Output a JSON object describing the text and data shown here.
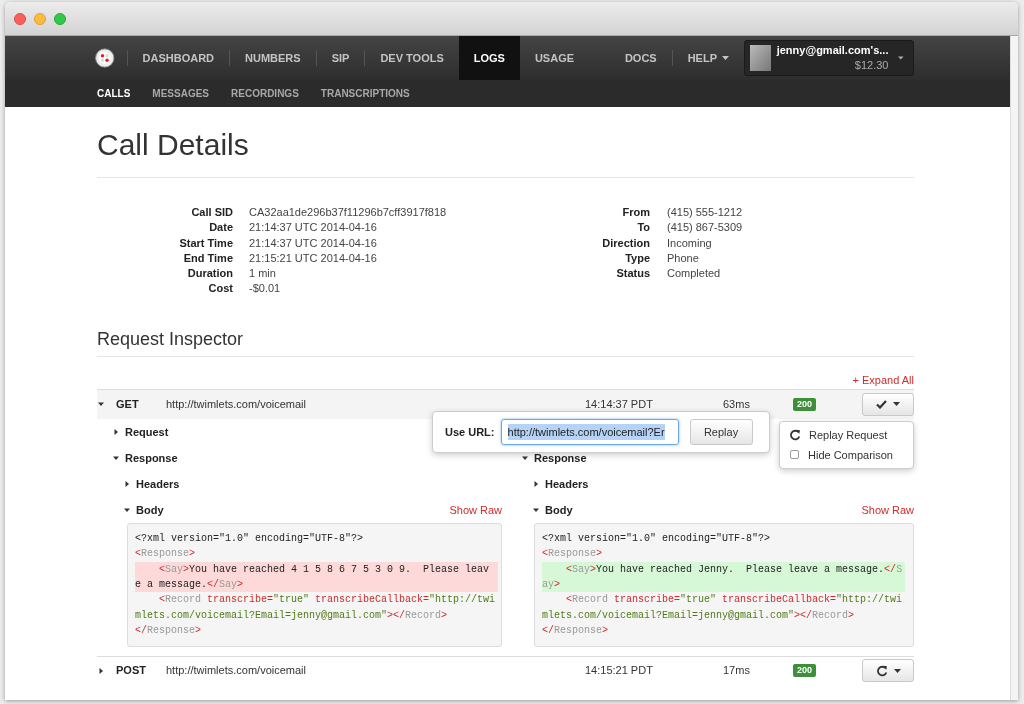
{
  "nav": {
    "main": [
      {
        "label": "DASHBOARD",
        "selected": false,
        "dropdown": false
      },
      {
        "label": "NUMBERS",
        "selected": false,
        "dropdown": false
      },
      {
        "label": "SIP",
        "selected": false,
        "dropdown": false
      },
      {
        "label": "DEV TOOLS",
        "selected": false,
        "dropdown": false
      },
      {
        "label": "LOGS",
        "selected": true,
        "dropdown": false
      },
      {
        "label": "USAGE",
        "selected": false,
        "dropdown": false
      }
    ],
    "secondary": [
      {
        "label": "DOCS",
        "selected": false,
        "dropdown": false
      },
      {
        "label": "HELP",
        "selected": false,
        "dropdown": true
      }
    ],
    "account": {
      "name": "jenny@gmail.com's...",
      "balance": "$12.30"
    }
  },
  "subnav": [
    {
      "label": "CALLS",
      "selected": true
    },
    {
      "label": "MESSAGES",
      "selected": false
    },
    {
      "label": "RECORDINGS",
      "selected": false
    },
    {
      "label": "TRANSCRIPTIONS",
      "selected": false
    }
  ],
  "title": "Call Details",
  "details_left": [
    {
      "label": "Call SID",
      "value": "CA32aa1de296b37f11296b7cff3917f818"
    },
    {
      "label": "Date",
      "value": "21:14:37 UTC 2014-04-16"
    },
    {
      "label": "Start Time",
      "value": "21:14:37 UTC 2014-04-16"
    },
    {
      "label": "End Time",
      "value": "21:15:21 UTC 2014-04-16"
    },
    {
      "label": "Duration",
      "value": "1 min"
    },
    {
      "label": "Cost",
      "value": "-$0.01"
    }
  ],
  "details_right": [
    {
      "label": "From",
      "value": "(415) 555-1212"
    },
    {
      "label": "To",
      "value": "(415) 867-5309"
    },
    {
      "label": "Direction",
      "value": "Incoming"
    },
    {
      "label": "Type",
      "value": "Phone"
    },
    {
      "label": "Status",
      "value": "Completed"
    }
  ],
  "inspector": {
    "title": "Request Inspector",
    "expand_all": "+ Expand All",
    "requests": [
      {
        "method": "GET",
        "url": "http://twimlets.com/voicemail",
        "time": "14:14:37 PDT",
        "duration": "63ms",
        "status": "200",
        "kind": "check",
        "expanded": true,
        "columns": [
          {
            "sections": [
              {
                "label": "Request",
                "expanded": false
              },
              {
                "label": "Response",
                "expanded": true,
                "children": [
                  {
                    "label": "Headers",
                    "expanded": false
                  },
                  {
                    "label": "Body",
                    "expanded": true,
                    "link": "Show Raw",
                    "code": [
                      {
                        "kind": "plain",
                        "tokens": [
                          {
                            "kind": "text",
                            "text": "<?xml version=\"1.0\" encoding=\"UTF-8\"?>"
                          }
                        ]
                      },
                      {
                        "kind": "plain",
                        "tokens": [
                          {
                            "kind": "punct",
                            "text": "<"
                          },
                          {
                            "kind": "tag",
                            "text": "Response"
                          },
                          {
                            "kind": "punct",
                            "text": ">"
                          }
                        ]
                      },
                      {
                        "kind": "removed",
                        "tokens": [
                          {
                            "kind": "punct",
                            "text": "    <"
                          },
                          {
                            "kind": "tag",
                            "text": "Say"
                          },
                          {
                            "kind": "punct",
                            "text": ">"
                          },
                          {
                            "kind": "text",
                            "text": "You have reached 4 1 5 8 6 7 5 3 0 9.  Please leave a message."
                          },
                          {
                            "kind": "punct",
                            "text": "</"
                          },
                          {
                            "kind": "tag",
                            "text": "Say"
                          },
                          {
                            "kind": "punct",
                            "text": ">"
                          }
                        ]
                      },
                      {
                        "kind": "plain",
                        "tokens": [
                          {
                            "kind": "punct",
                            "text": "    <"
                          },
                          {
                            "kind": "tag",
                            "text": "Record"
                          },
                          {
                            "kind": "attr",
                            "text": " transcribe="
                          },
                          {
                            "kind": "value",
                            "text": "\"true\""
                          },
                          {
                            "kind": "attr",
                            "text": " transcribeCallback="
                          },
                          {
                            "kind": "value",
                            "text": "\"http://twimlets.com/voicemail?Email=jenny@gmail.com\""
                          },
                          {
                            "kind": "punct",
                            "text": "></"
                          },
                          {
                            "kind": "tag",
                            "text": "Record"
                          },
                          {
                            "kind": "punct",
                            "text": ">"
                          }
                        ]
                      },
                      {
                        "kind": "plain",
                        "tokens": [
                          {
                            "kind": "punct",
                            "text": "</"
                          },
                          {
                            "kind": "tag",
                            "text": "Response"
                          },
                          {
                            "kind": "punct",
                            "text": ">"
                          }
                        ]
                      }
                    ]
                  }
                ]
              }
            ]
          },
          {
            "sections": [
              {
                "label": "Response",
                "expanded": true,
                "children": [
                  {
                    "label": "Headers",
                    "expanded": false
                  },
                  {
                    "label": "Body",
                    "expanded": true,
                    "link": "Show Raw",
                    "code": [
                      {
                        "kind": "plain",
                        "tokens": [
                          {
                            "kind": "text",
                            "text": "<?xml version=\"1.0\" encoding=\"UTF-8\"?>"
                          }
                        ]
                      },
                      {
                        "kind": "plain",
                        "tokens": [
                          {
                            "kind": "punct",
                            "text": "<"
                          },
                          {
                            "kind": "tag",
                            "text": "Response"
                          },
                          {
                            "kind": "punct",
                            "text": ">"
                          }
                        ]
                      },
                      {
                        "kind": "added",
                        "tokens": [
                          {
                            "kind": "punct",
                            "text": "    <"
                          },
                          {
                            "kind": "tag",
                            "text": "Say"
                          },
                          {
                            "kind": "punct",
                            "text": ">"
                          },
                          {
                            "kind": "text",
                            "text": "You have reached Jenny.  Please leave a message."
                          },
                          {
                            "kind": "punct",
                            "text": "</"
                          },
                          {
                            "kind": "tag",
                            "text": "Say"
                          },
                          {
                            "kind": "punct",
                            "text": ">"
                          }
                        ]
                      },
                      {
                        "kind": "plain",
                        "tokens": [
                          {
                            "kind": "punct",
                            "text": "    <"
                          },
                          {
                            "kind": "tag",
                            "text": "Record"
                          },
                          {
                            "kind": "attr",
                            "text": " transcribe="
                          },
                          {
                            "kind": "value",
                            "text": "\"true\""
                          },
                          {
                            "kind": "attr",
                            "text": " transcribeCallback="
                          },
                          {
                            "kind": "value",
                            "text": "\"http://twimlets.com/voicemail?Email=jenny@gmail.com\""
                          },
                          {
                            "kind": "punct",
                            "text": "></"
                          },
                          {
                            "kind": "tag",
                            "text": "Record"
                          },
                          {
                            "kind": "punct",
                            "text": ">"
                          }
                        ]
                      },
                      {
                        "kind": "plain",
                        "tokens": [
                          {
                            "kind": "punct",
                            "text": "</"
                          },
                          {
                            "kind": "tag",
                            "text": "Response"
                          },
                          {
                            "kind": "punct",
                            "text": ">"
                          }
                        ]
                      }
                    ]
                  }
                ]
              }
            ]
          }
        ],
        "popover": {
          "label": "Use URL:",
          "value": "http://twimlets.com/voicemail?Er",
          "button": "Replay"
        },
        "menu": [
          {
            "kind": "action",
            "label": "Replay Request"
          },
          {
            "kind": "checkbox",
            "label": "Hide Comparison",
            "checked": false
          }
        ]
      },
      {
        "method": "POST",
        "url": "http://twimlets.com/voicemail",
        "time": "14:15:21 PDT",
        "duration": "17ms",
        "status": "200",
        "kind": "replay",
        "expanded": false
      }
    ]
  }
}
